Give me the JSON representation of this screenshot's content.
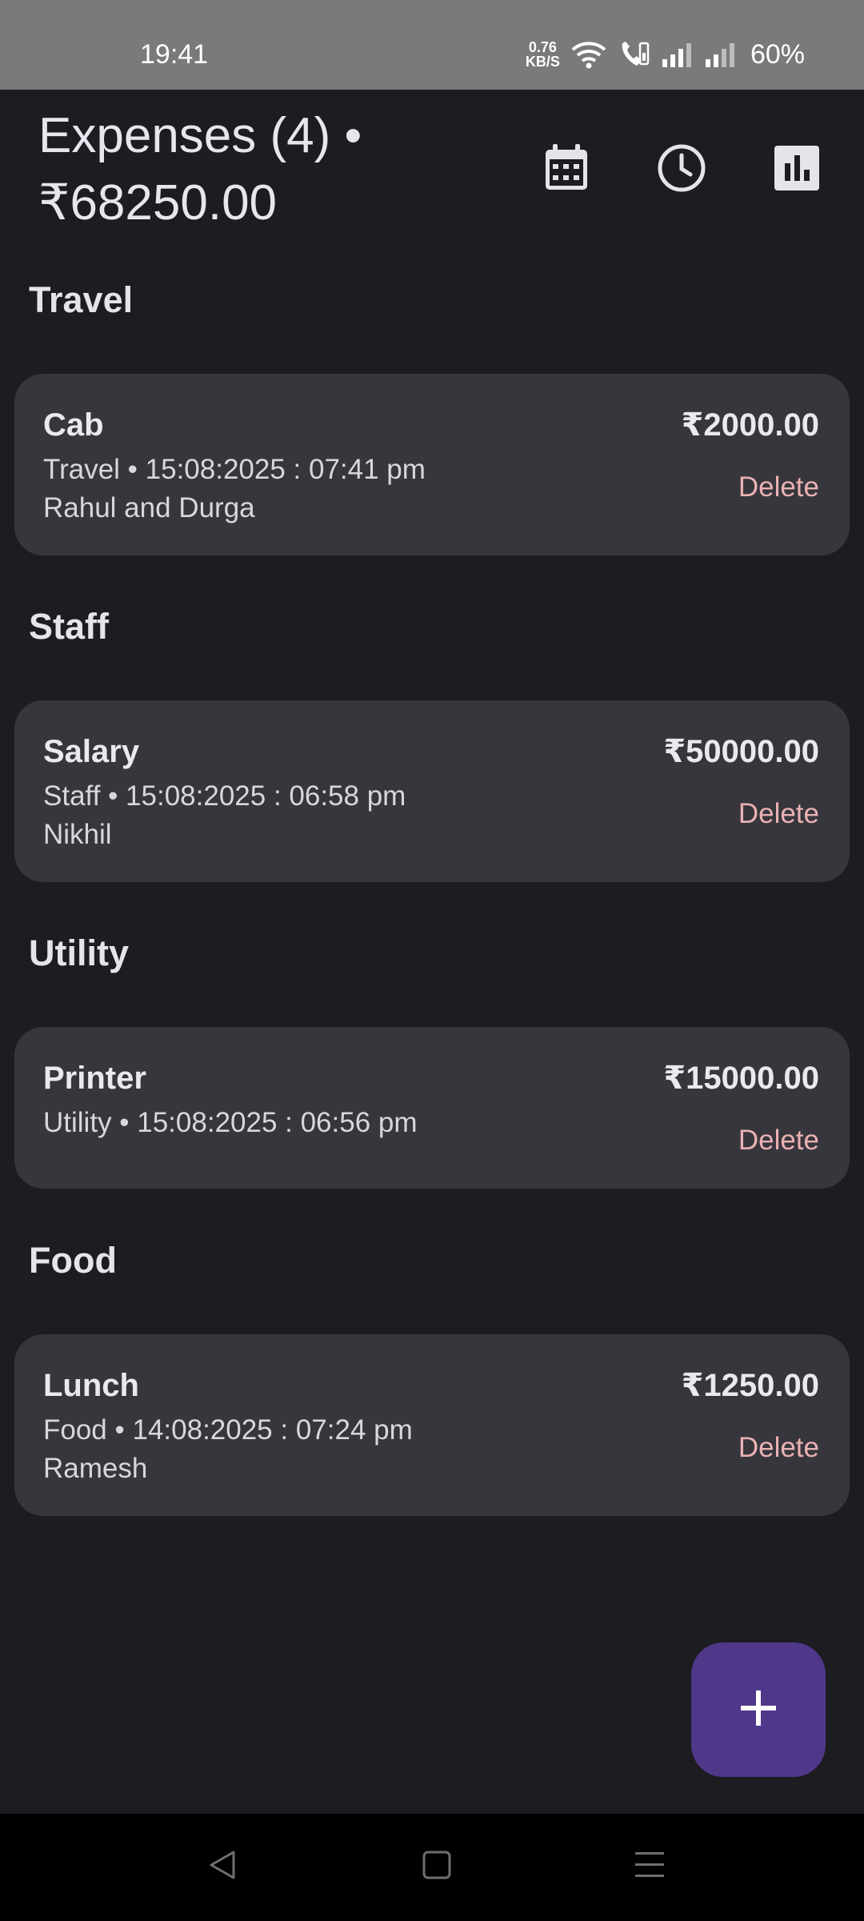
{
  "status_bar": {
    "time": "19:41",
    "net_speed_value": "0.76",
    "net_speed_unit": "KB/S",
    "battery": "60%",
    "icons": [
      "wifi-icon",
      "wifi-call-icon",
      "signal-icon",
      "signal-icon",
      "battery-icon"
    ]
  },
  "header": {
    "title": "Expenses (4) • ₹68250.00",
    "actions": [
      "calendar-icon",
      "clock-icon",
      "bar-chart-icon"
    ]
  },
  "sections": [
    {
      "title": "Travel",
      "expenses": [
        {
          "name": "Cab",
          "meta": "Travel • 15:08:2025 : 07:41 pm",
          "note": "Rahul and Durga",
          "amount": "₹2000.00",
          "delete_label": "Delete"
        }
      ]
    },
    {
      "title": "Staff",
      "expenses": [
        {
          "name": "Salary",
          "meta": "Staff • 15:08:2025 : 06:58 pm",
          "note": "Nikhil",
          "amount": "₹50000.00",
          "delete_label": "Delete"
        }
      ]
    },
    {
      "title": "Utility",
      "expenses": [
        {
          "name": "Printer",
          "meta": "Utility • 15:08:2025 : 06:56 pm",
          "note": "",
          "amount": "₹15000.00",
          "delete_label": "Delete"
        }
      ]
    },
    {
      "title": "Food",
      "expenses": [
        {
          "name": "Lunch",
          "meta": "Food • 14:08:2025 : 07:24 pm",
          "note": "Ramesh",
          "amount": "₹1250.00",
          "delete_label": "Delete"
        }
      ]
    }
  ],
  "fab": {
    "icon": "plus-icon"
  },
  "nav_bar": {
    "icons": [
      "back-icon",
      "home-icon",
      "recents-icon"
    ]
  },
  "colors": {
    "background": "#1d1c21",
    "card": "#37363c",
    "delete_text": "#eab1b3",
    "fab": "#4f378a",
    "status_bar": "#7a7a7a"
  }
}
